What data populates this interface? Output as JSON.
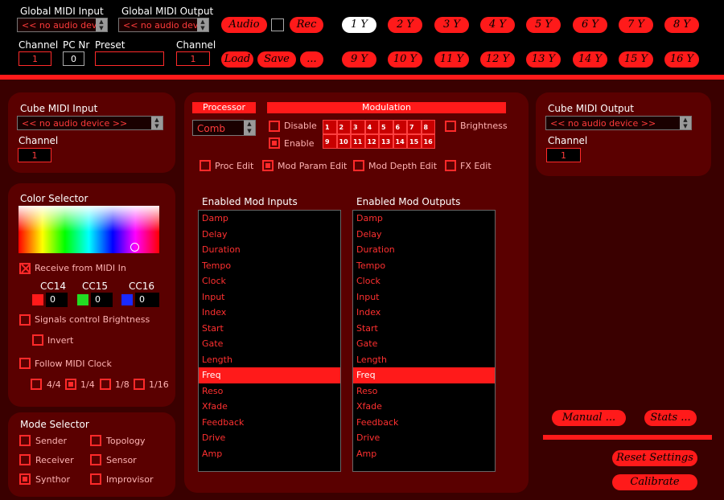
{
  "top": {
    "global_midi_input_label": "Global MIDI Input",
    "global_midi_input_value": "<< no audio devic...",
    "global_midi_output_label": "Global MIDI Output",
    "global_midi_output_value": "<< no audio devic...",
    "channel_label": "Channel",
    "channel_value": "1",
    "pc_nr_label": "PC Nr",
    "pc_nr_value": "0",
    "preset_label": "Preset",
    "preset_value": "",
    "channel2_label": "Channel",
    "channel2_value": "1",
    "audio_label": "Audio",
    "rec_label": "Rec",
    "load_label": "Load",
    "save_label": "Save",
    "more_label": "...",
    "voices_row1": [
      "1 Y",
      "2 Y",
      "3 Y",
      "4 Y",
      "5 Y",
      "6 Y",
      "7 Y",
      "8 Y"
    ],
    "voices_row2": [
      "9 Y",
      "10 Y",
      "11 Y",
      "12 Y",
      "13 Y",
      "14 Y",
      "15 Y",
      "16 Y"
    ]
  },
  "cube_in": {
    "title": "Cube MIDI Input",
    "device": "<< no audio device >>",
    "channel_label": "Channel",
    "channel_value": "1"
  },
  "color_selector": {
    "title": "Color Selector",
    "receive_label": "Receive from MIDI In",
    "cc_labels": [
      "CC14",
      "CC15",
      "CC16"
    ],
    "cc_values": [
      "0",
      "0",
      "0"
    ],
    "cc_colors": [
      "#ff1a1a",
      "#22dd22",
      "#1a2aff"
    ],
    "signals_label": "Signals control Brightness",
    "invert_label": "Invert",
    "follow_clock_label": "Follow MIDI Clock",
    "clock_options": [
      "4/4",
      "1/4",
      "1/8",
      "1/16"
    ],
    "clock_selected": "1/4"
  },
  "mode_selector": {
    "title": "Mode Selector",
    "options": [
      "Sender",
      "Topology",
      "Receiver",
      "Sensor",
      "Synthor",
      "Improvisor"
    ],
    "selected": "Synthor"
  },
  "processor": {
    "header": "Processor",
    "value": "Comb"
  },
  "modulation": {
    "header": "Modulation",
    "disable_label": "Disable",
    "enable_label": "Enable",
    "brightness_label": "Brightness",
    "row1": [
      "1",
      "2",
      "3",
      "4",
      "5",
      "6",
      "7",
      "8"
    ],
    "row2": [
      "9",
      "10",
      "11",
      "12",
      "13",
      "14",
      "15",
      "16"
    ]
  },
  "edit_modes": {
    "proc_edit": "Proc Edit",
    "mod_param_edit": "Mod Param Edit",
    "mod_depth_edit": "Mod Depth Edit",
    "fx_edit": "FX Edit"
  },
  "mod_inputs": {
    "title": "Enabled Mod Inputs",
    "items": [
      "Damp",
      "Delay",
      "Duration",
      "Tempo",
      "Clock",
      "Input",
      "Index",
      "Start",
      "Gate",
      "Length",
      "Freq",
      "Reso",
      "Xfade",
      "Feedback",
      "Drive",
      "Amp"
    ],
    "selected": "Freq"
  },
  "mod_outputs": {
    "title": "Enabled Mod Outputs",
    "items": [
      "Damp",
      "Delay",
      "Duration",
      "Tempo",
      "Clock",
      "Input",
      "Index",
      "Start",
      "Gate",
      "Length",
      "Freq",
      "Reso",
      "Xfade",
      "Feedback",
      "Drive",
      "Amp"
    ],
    "selected": "Freq"
  },
  "cube_out": {
    "title": "Cube MIDI Output",
    "device": "<< no audio device >>",
    "channel_label": "Channel",
    "channel_value": "1"
  },
  "actions": {
    "manual": "Manual ...",
    "stats": "Stats ...",
    "reset": "Reset Settings",
    "calibrate": "Calibrate"
  }
}
